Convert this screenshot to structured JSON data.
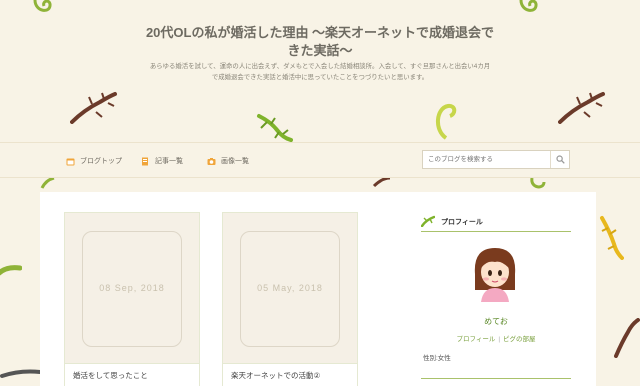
{
  "site": {
    "title": "20代OLの私が婚活した理由 ～楽天オーネットで成婚退会できた実話～",
    "description": "あらゆる婚活を試して、運命の人に出会えず、ダメもとで入会した結婚相談所。入会して、すぐ旦那さんと出会い4カ月で成婚退会できた実話と婚活中に思っていたことをつづりたいと思います。"
  },
  "nav": {
    "items": [
      {
        "label": "ブログトップ",
        "icon": "calendar-icon"
      },
      {
        "label": "記事一覧",
        "icon": "document-icon"
      },
      {
        "label": "画像一覧",
        "icon": "camera-icon"
      }
    ],
    "search_placeholder": "このブログを検索する",
    "search_icon": "search-icon"
  },
  "posts": [
    {
      "date": "08 Sep, 2018",
      "title": "婚活をして思ったこと"
    },
    {
      "date": "05 May, 2018",
      "title": "楽天オーネットでの活動②"
    }
  ],
  "sidebar": {
    "heading": "プロフィール",
    "name": "めてお",
    "link_profile": "プロフィール",
    "link_separator": "|",
    "link_pigg": "ピグの部屋",
    "gender": "性別:女性"
  },
  "colors": {
    "background": "#f8f3e6",
    "accent_green": "#a9c26b",
    "link_green": "#7aa03e",
    "nav_icon_orange": "#f0a53a"
  }
}
